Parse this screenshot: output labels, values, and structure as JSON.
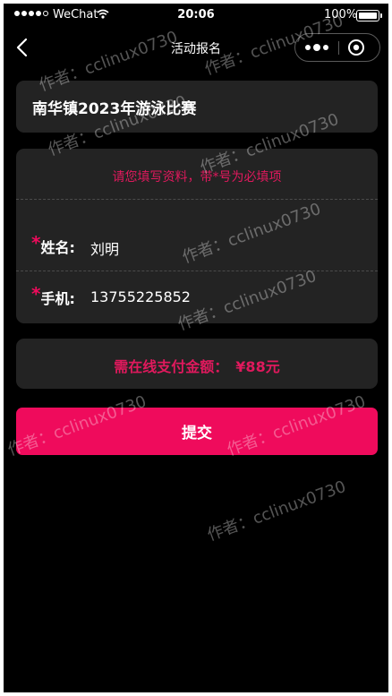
{
  "status_bar": {
    "carrier": "WeChat",
    "time": "20:06",
    "battery": "100%"
  },
  "nav": {
    "title": "活动报名"
  },
  "event": {
    "title": "南华镇2023年游泳比赛"
  },
  "form": {
    "hint": "请您填写资料，带*号为必填项",
    "required_mark": "*",
    "fields": [
      {
        "label": "姓名:",
        "value": "刘明"
      },
      {
        "label": "手机:",
        "value": "13755225852"
      }
    ]
  },
  "payment": {
    "label": "需在线支付金额：",
    "amount": "¥88元"
  },
  "submit_label": "提交",
  "watermark": "作者：cclinux0730",
  "colors": {
    "accent": "#ef0b5c",
    "hint": "#e0195d",
    "card": "#232323",
    "background": "#000000"
  }
}
